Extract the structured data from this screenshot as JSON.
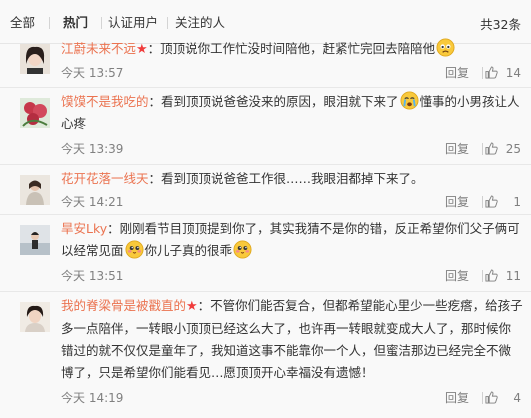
{
  "filters": {
    "all": "全部",
    "hot": "热门",
    "verified": "认证用户",
    "following": "关注的人",
    "total": "共32条"
  },
  "comments": [
    {
      "user": "江蔚未来不远",
      "badge": "★",
      "text": "：顶顶说你工作忙没时间陪他，赶紧忙完回去陪陪他",
      "emoji": "sad-face-emoji",
      "time": "今天 13:57",
      "reply": "回复",
      "likes": "14"
    },
    {
      "user": "馍馍不是我吃的",
      "text_a": "：看到顶顶说爸爸没来的原因，眼泪就下来了",
      "emoji": "crying-face-emoji",
      "text_b": "懂事的小男孩让人心疼",
      "time": "今天 13:39",
      "reply": "回复",
      "likes": "25"
    },
    {
      "user": "花开花落一线天",
      "text": "：看到顶顶说爸爸工作很……我眼泪都掉下来了。",
      "time": "今天 14:21",
      "reply": "回复",
      "likes": "1"
    },
    {
      "user": "旱安Lky",
      "text_a": "：刚刚看节目顶顶提到你了，其实我猜不是你的错，反正希望你们父子俩可以经常见面",
      "emoji1": "cute-face-emoji",
      "text_b": "你儿子真的很乖",
      "emoji2": "cute-face-emoji",
      "time": "今天 13:51",
      "reply": "回复",
      "likes": "11"
    },
    {
      "user": "我的脊梁骨是被戳直的",
      "badge": "★",
      "text": "：不管你们能否复合，但都希望能心里少一些疙瘩，给孩子多一点陪伴，一转眼小顶顶已经这么大了，也许再一转眼就变成大人了，那时候你错过的就不仅仅是童年了，我知道这事不能靠你一个人，但蜜洁那边已经完全不微博了，只是希望你们能看见…愿顶顶开心幸福没有遗憾！",
      "time": "今天 14:19",
      "reply": "回复",
      "likes": "4"
    }
  ],
  "colors": {
    "username": "#eb7350",
    "meta": "#808080",
    "badge": "#f03c3c"
  }
}
